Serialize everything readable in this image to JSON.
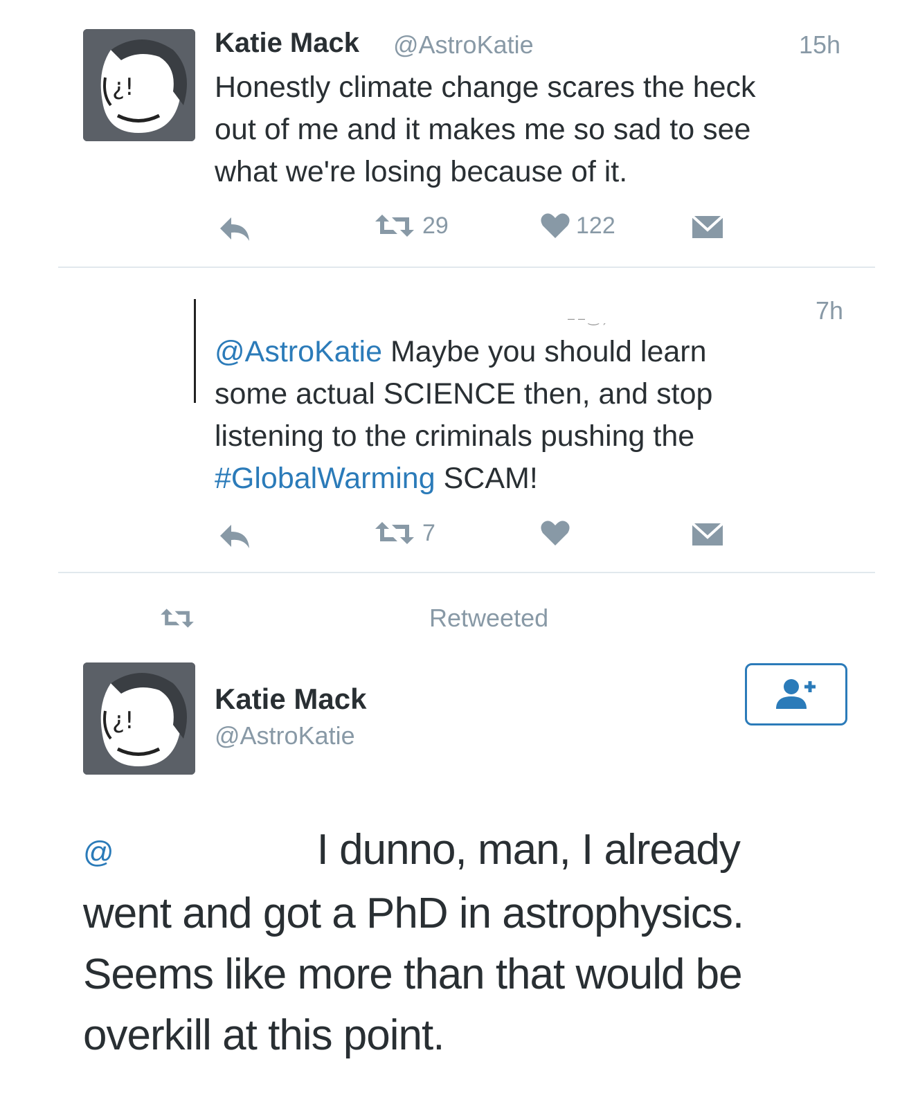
{
  "tweet1": {
    "author_name": "Katie Mack",
    "author_handle": "@AstroKatie",
    "time": "15h",
    "text_lines": [
      "Honestly climate change scares the heck",
      "out of me and it makes me so sad to see",
      "what we're losing because of it."
    ],
    "retweet_count": "29",
    "like_count": "122"
  },
  "tweet2": {
    "time": "7h",
    "mention": "@AstroKatie",
    "line1_rest": " Maybe you should learn",
    "line2": "some actual SCIENCE then, and stop",
    "line3": "listening to the criminals pushing the",
    "hashtag": "#GlobalWarming",
    "line4_rest": " SCAM!",
    "retweet_count": "7"
  },
  "retweeted_label": "Retweeted",
  "tweet3": {
    "author_name": "Katie Mack",
    "author_handle": "@AstroKatie",
    "mention": "@",
    "line1_rest": "I dunno, man, I already",
    "line2": "went and got a PhD in astrophysics.",
    "line3": "Seems like more than that would be",
    "line4": "overkill at this point."
  },
  "colors": {
    "link": "#2b7bb9",
    "muted": "#8899a6",
    "text": "#292f33"
  }
}
